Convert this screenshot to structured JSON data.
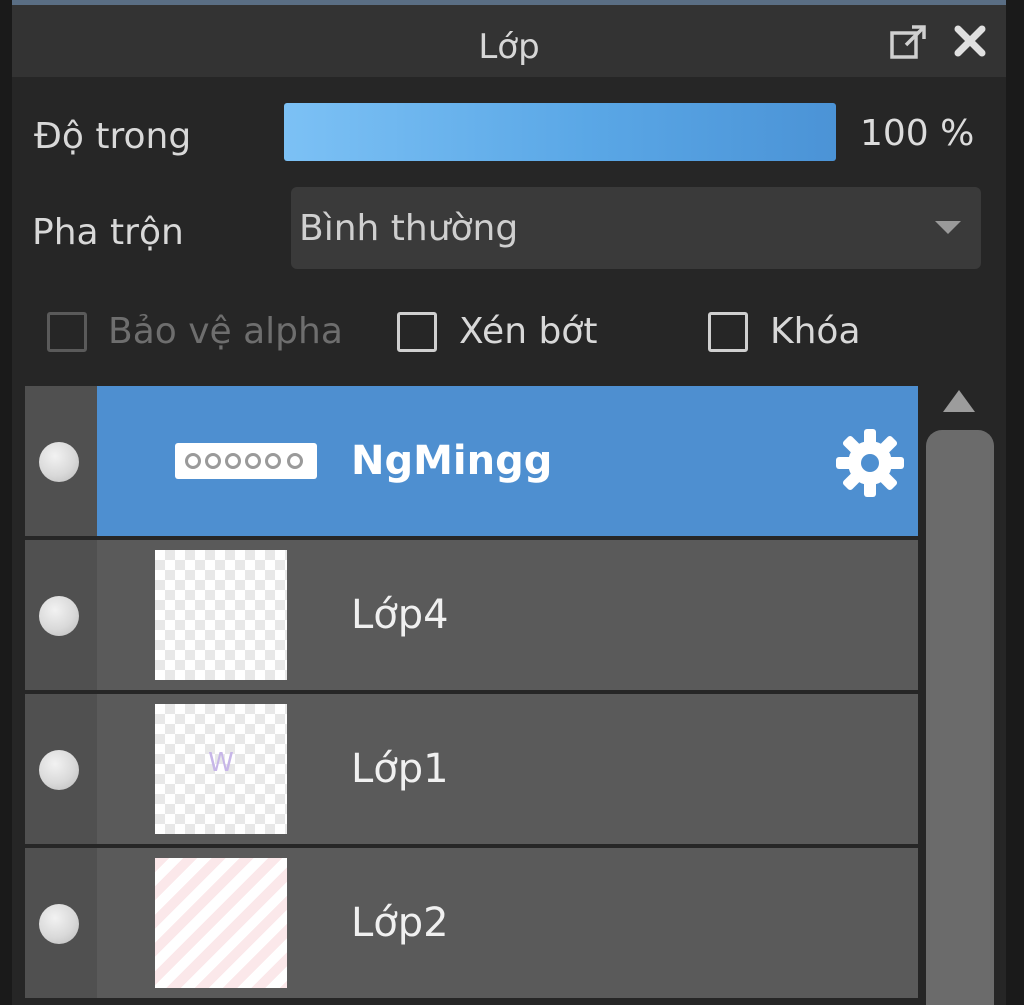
{
  "panel": {
    "title": "Lớp"
  },
  "controls": {
    "opacity_label": "Độ trong",
    "opacity_value_text": "100 %",
    "opacity_fraction": 1.0,
    "blend_label": "Pha trộn",
    "blend_value": "Bình thường",
    "checkboxes": [
      {
        "label": "Bảo vệ alpha",
        "checked": false,
        "enabled": false
      },
      {
        "label": "Xén bớt",
        "checked": false,
        "enabled": true
      },
      {
        "label": "Khóa",
        "checked": false,
        "enabled": true
      }
    ]
  },
  "layers": [
    {
      "name": "NgMingg",
      "selected": true,
      "visible": true,
      "type": "text"
    },
    {
      "name": "Lớp4",
      "selected": false,
      "visible": true,
      "type": "empty"
    },
    {
      "name": "Lớp1",
      "selected": false,
      "visible": true,
      "type": "sketch",
      "thumb_mark": "W"
    },
    {
      "name": "Lớp2",
      "selected": false,
      "visible": true,
      "type": "stripes"
    }
  ],
  "colors": {
    "accent": "#4e8fd0",
    "opacity_fill": "#5aa7e6",
    "panel_bg": "#262626",
    "row_bg": "#5a5a5a"
  },
  "icons": {
    "popout": "popout-icon",
    "close": "close-icon",
    "settings": "gear-icon",
    "visibility": "visibility-dot-icon",
    "scroll_up": "triangle-up-icon",
    "dropdown": "chevron-down-icon"
  }
}
